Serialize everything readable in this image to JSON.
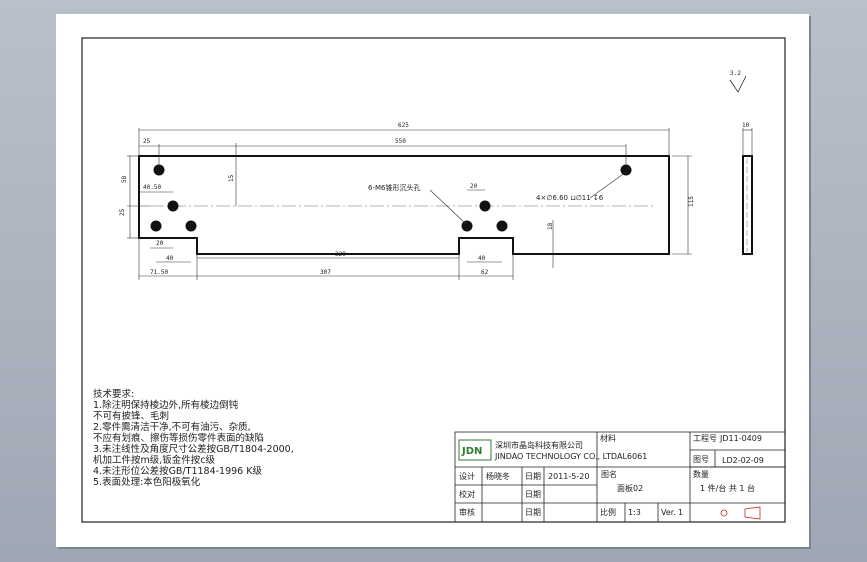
{
  "drawing": {
    "dims": {
      "overall_length": "625",
      "hole_pitch": "550",
      "edge_offset": "25",
      "height_left": "58",
      "hole_y": "15",
      "hole_x": "40.50",
      "low_y": "25",
      "slot_w": "20",
      "spacing_40a": "40",
      "len_329": "329",
      "spacing_40b": "40",
      "slot_w_b": "20",
      "depth_18": "18",
      "height_right": "115",
      "pos_71_50": "71.50",
      "pos_307": "307",
      "pos_62": "62",
      "thickness": "10",
      "finish_roughness": "3.2"
    },
    "callouts": {
      "countersink": "6-M6锥形沉头孔",
      "hole_spec": "4×∅6.60 ⊔∅11 ↧6"
    }
  },
  "notes": {
    "title": "技术要求:",
    "lines": [
      "1.除注明保持棱边外,所有棱边倒钝",
      "  不可有披锋、毛刺",
      "2.零件需清洁干净,不可有油污、杂质,",
      "  不应有划痕、擦伤等损伤零件表面的缺陷",
      "3.未注线性及角度尺寸公差按GB/T1804-2000,",
      "  机加工件按m级,钣金件按c级",
      "4.未注形位公差按GB/T1184-1996 K级",
      "5.表面处理:本色阳极氧化"
    ]
  },
  "titleblock": {
    "logo": "JDN",
    "company_cn": "深圳市晶岛科技有限公司",
    "company_en": "JINDAO TECHNOLOGY CO., LTD",
    "material_label": "材料",
    "material": "AL6061",
    "project_label": "工程号",
    "project": "JD11-0409",
    "drawing_no_label": "图号",
    "drawing_no": "LD2-02-09",
    "quantity_label": "数量",
    "quantity": "1 件/台  共 1 台",
    "design_label": "设计",
    "designer": "杨晓冬",
    "date_label": "日期",
    "date": "2011-5-20",
    "check_label": "校对",
    "date_label2": "日期",
    "review_label": "审核",
    "date_label3": "日期",
    "name_label": "图名",
    "name": "面板02",
    "scale_label": "比例",
    "scale": "1:3",
    "version_label": "Ver.",
    "version": "1"
  }
}
